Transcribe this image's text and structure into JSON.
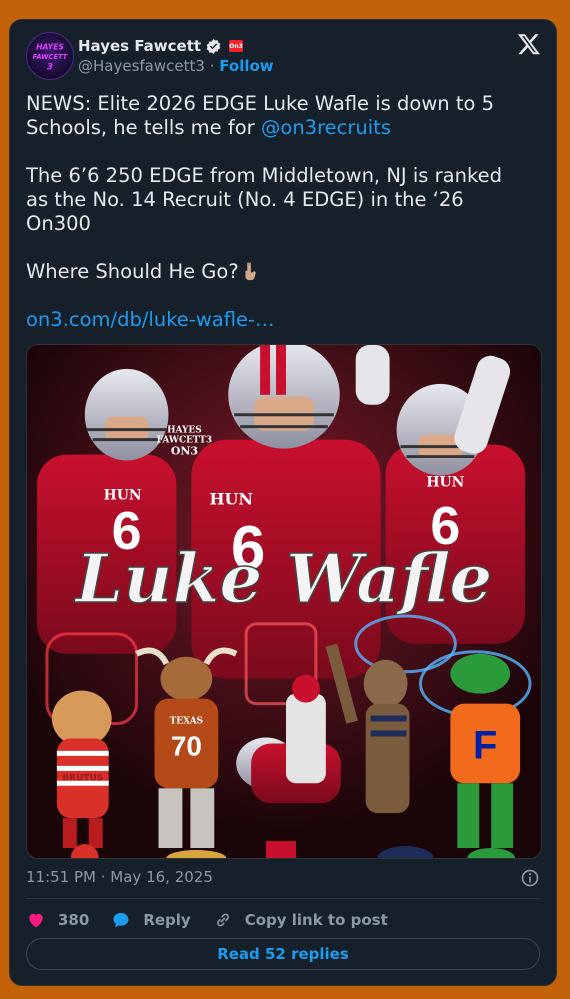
{
  "author": {
    "name": "Hayes Fawcett",
    "handle": "@Hayesfawcett3",
    "separator": "·",
    "follow_label": "Follow",
    "badge_text": "On3",
    "avatar_text": [
      "HAYES",
      "FAWCETT",
      "3"
    ]
  },
  "tweet": {
    "line1_text": "NEWS: Elite 2026 EDGE Luke Wafle is down to 5 Schools, he tells me for ",
    "line1_mention": "@on3recruits",
    "paragraph2": "The 6’6 250 EDGE from Middletown, NJ is ranked as the No. 14 Recruit (No. 4 EDGE) in the ‘26 On300",
    "paragraph3": "Where Should He Go?",
    "link": "on3.com/db/luke-wafle-…"
  },
  "media": {
    "graphic_title": "Luke Wafle",
    "watermark": [
      "HAYES",
      "FAWCETT3",
      "ON3"
    ],
    "jersey_text": "HUN",
    "jersey_number": "6",
    "mascot_number": "70",
    "mascot_texas": "TEXAS",
    "mascot_brutus": "BRUTUS",
    "mascot_florida": "F"
  },
  "meta": {
    "timestamp": "11:51 PM · May 16, 2025"
  },
  "actions": {
    "likes": "380",
    "reply_label": "Reply",
    "copy_label": "Copy link to post",
    "read_replies": "Read 52 replies"
  },
  "colors": {
    "page_bg": "#c4620a",
    "card_bg": "#15202b",
    "accent": "#1d9bf0",
    "like": "#f91880"
  }
}
